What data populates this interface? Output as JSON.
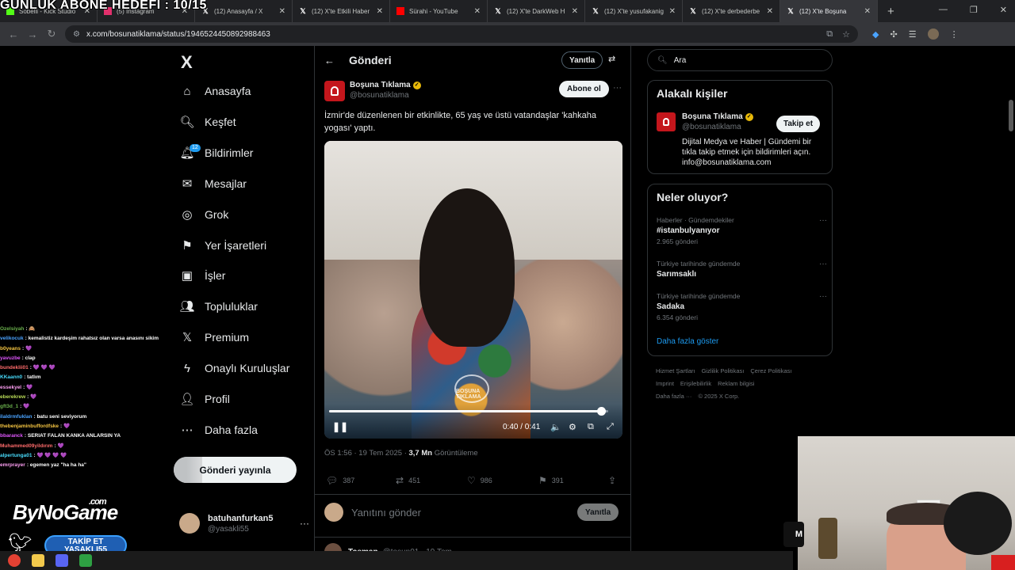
{
  "overlay_title": "GÜNLÜK ABONE HEDEFİ : 10/15",
  "browser": {
    "tabs": [
      {
        "label": "Sobelli - Kick Studio",
        "icon": "kick",
        "color": "#53fc18"
      },
      {
        "label": "(5) Instagram",
        "icon": "instagram",
        "color": "#e1306c"
      },
      {
        "label": "(12) Anasayfa / X",
        "icon": "x",
        "color": "#ffffff"
      },
      {
        "label": "(12) X'te Etkili Haber",
        "icon": "x",
        "color": "#ffffff"
      },
      {
        "label": "Sürahi - YouTube",
        "icon": "youtube",
        "color": "#ff0000"
      },
      {
        "label": "(12) X'te DarkWeb H",
        "icon": "x",
        "color": "#ffffff"
      },
      {
        "label": "(12) X'te yusufakanig",
        "icon": "x",
        "color": "#ffffff"
      },
      {
        "label": "(12) X'te derbederbe",
        "icon": "x",
        "color": "#ffffff"
      },
      {
        "label": "(12) X'te Boşuna",
        "icon": "x",
        "color": "#ffffff",
        "active": true
      }
    ],
    "url": "x.com/bosunatiklama/status/1946524450892988463"
  },
  "sidebar": {
    "logo": "X",
    "items": [
      {
        "label": "Anasayfa",
        "icon": "home-icon"
      },
      {
        "label": "Keşfet",
        "icon": "search-icon"
      },
      {
        "label": "Bildirimler",
        "icon": "bell-icon",
        "badge": "12"
      },
      {
        "label": "Mesajlar",
        "icon": "mail-icon"
      },
      {
        "label": "Grok",
        "icon": "grok-icon"
      },
      {
        "label": "Yer İşaretleri",
        "icon": "bookmark-icon"
      },
      {
        "label": "İşler",
        "icon": "briefcase-icon"
      },
      {
        "label": "Topluluklar",
        "icon": "communities-icon"
      },
      {
        "label": "Premium",
        "icon": "x-icon"
      },
      {
        "label": "Onaylı Kuruluşlar",
        "icon": "lightning-icon"
      },
      {
        "label": "Profil",
        "icon": "profile-icon"
      },
      {
        "label": "Daha fazla",
        "icon": "more-circle-icon"
      }
    ],
    "post_button": "Gönderi yayınla",
    "user": {
      "name": "batuhanfurkan5",
      "handle": "@yasakli55"
    }
  },
  "main": {
    "title": "Gönderi",
    "reply_pill": "Yanıtla",
    "author": {
      "name": "Boşuna Tıklama",
      "handle": "@bosunatiklama"
    },
    "follow_label": "Abone ol",
    "text": "İzmir'de düzenlenen bir etkinlikte, 65 yaş ve üstü vatandaşlar 'kahkaha yogası' yaptı.",
    "video": {
      "time": "0:40 / 0:41",
      "progress": 0.975,
      "watermark": "BOŞUNA TIKLAMA"
    },
    "meta": {
      "time": "ÖS 1:56 · 19 Tem 2025 · ",
      "views": "3,7 Mn",
      "views_label": " Görüntüleme"
    },
    "actions": {
      "replies": "387",
      "reposts": "451",
      "likes": "986",
      "bookmarks": "391"
    },
    "compose_placeholder": "Yanıtını gönder",
    "compose_button": "Yanıtla",
    "next_post": {
      "name": "Tosman",
      "handle": "@tosun01 · 19 Tem"
    }
  },
  "right": {
    "search_placeholder": "Ara",
    "related_title": "Alakalı kişiler",
    "related_person": {
      "name": "Boşuna Tıklama",
      "handle": "@bosunatiklama",
      "follow": "Takip et",
      "bio": "Dijital Medya ve Haber | Gündemi bir tıkla takip etmek için bildirimleri açın. info@bosunatiklama.com"
    },
    "trends_title": "Neler oluyor?",
    "trends": [
      {
        "category": "Haberler · Gündemdekiler",
        "name": "#istanbulyanıyor",
        "count": "2.965 gönderi"
      },
      {
        "category": "Türkiye tarihinde gündemde",
        "name": "Sarımsaklı",
        "count": ""
      },
      {
        "category": "Türkiye tarihinde gündemde",
        "name": "Sadaka",
        "count": "6.354 gönderi"
      }
    ],
    "show_more": "Daha fazla göster",
    "footer": [
      "Hizmet Şartları",
      "Gizlilik Politikası",
      "Çerez Politikası",
      "Imprint",
      "Erişilebilirlik",
      "Reklam bilgisi",
      "Daha fazla ···",
      "© 2025 X Corp."
    ]
  },
  "stream": {
    "chat": [
      {
        "user": "Ozelsiyah",
        "msg": "",
        "emote": "🙈"
      },
      {
        "user": "velikocuk",
        "msg": "kemalistiz kardeşim rahatsız olan varsa anasını sikim",
        "emote": ""
      },
      {
        "user": "b0yeans",
        "msg": "",
        "emote": "💜"
      },
      {
        "user": "yavuzbe",
        "msg": "clap",
        "emote": ""
      },
      {
        "user": "bundeklii01",
        "msg": "",
        "emote": "💜 💜 💜"
      },
      {
        "user": "KKaann0",
        "msg": "tatlım",
        "emote": ""
      },
      {
        "user": "essekyel",
        "msg": "",
        "emote": "💜"
      },
      {
        "user": "eberekrew",
        "msg": "",
        "emote": "💜"
      },
      {
        "user": "gft3d_1",
        "msg": "",
        "emote": "💜"
      },
      {
        "user": "ilaldrmfuklan",
        "msg": "batu seni seviyorum",
        "emote": ""
      },
      {
        "user": "thebenjaminbuffordfske",
        "msg": "",
        "emote": "💜"
      },
      {
        "user": "bbaranck",
        "msg": "SERIAT FALAN KANKA ANLARSIN YA",
        "emote": ""
      },
      {
        "user": "Muhammed09yildırım",
        "msg": "",
        "emote": "💜"
      },
      {
        "user": "alpertunga01",
        "msg": "",
        "emote": "💜 💜 💜 💜"
      },
      {
        "user": "emrprayer",
        "msg": "egemen yaz \"ha ha ha\"",
        "emote": ""
      }
    ],
    "brand": "ByNoGame",
    "brand_suffix": ".com",
    "cta": "TAKİP ET",
    "cta_handle": "YASAKLI55",
    "webcam_label": "M"
  }
}
